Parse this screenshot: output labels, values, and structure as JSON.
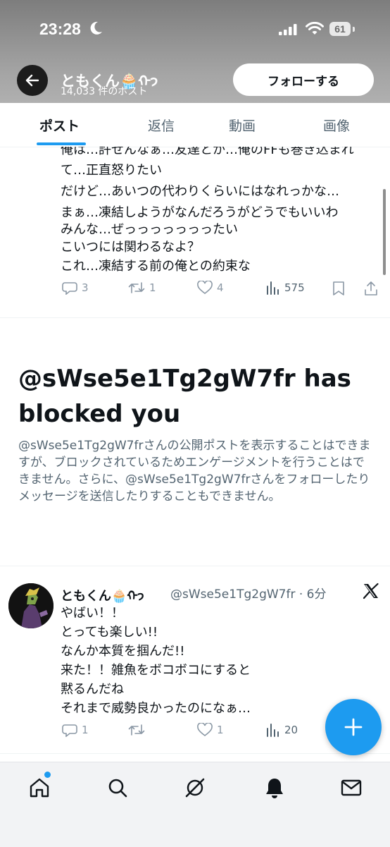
{
  "status_bar": {
    "time": "23:28",
    "battery": "61"
  },
  "header": {
    "name": "ともくん🧁ᡣ𐭩",
    "post_count": "14,033 件のポスト",
    "follow_label": "フォローする"
  },
  "tabs": [
    {
      "label": "ポスト",
      "active": true
    },
    {
      "label": "返信",
      "active": false
    },
    {
      "label": "動画",
      "active": false
    },
    {
      "label": "画像",
      "active": false
    }
  ],
  "post1": {
    "lines": [
      "俺は…許せんなぁ…友達とか…俺のFFも巻き込まれ",
      "て…正直怒りたい",
      "だけど…あいつの代わりくらいにはなれっかな…",
      "まぁ…凍結しようがなんだろうがどうでもいいわ",
      "みんな…ぜっっっっっっったい",
      "こいつには関わるなよ？",
      "これ…凍結する前の俺との約束な"
    ],
    "replies": "3",
    "reposts": "1",
    "likes": "4",
    "views": "575"
  },
  "blocked": {
    "title": "@sWse5e1Tg2gW7fr has blocked you",
    "description": "@sWse5e1Tg2gW7frさんの公開ポストを表示することはできますが、ブロックされているためエンゲージメントを行うことはできません。さらに、@sWse5e1Tg2gW7frさんをフォローしたりメッセージを送信したりすることもできません。"
  },
  "post2": {
    "name": "ともくん🧁ᡣ𐭩",
    "meta": "@sWse5e1Tg2gW7fr · 6分",
    "lines": [
      "やばい！！",
      "とっても楽しい!!",
      "なんか本質を掴んだ!!",
      "来た！！雑魚をボコボコにすると",
      "黙るんだね",
      "それまで威勢良かったのになぁ…"
    ],
    "replies": "1",
    "reposts": "",
    "likes": "1",
    "views": "20"
  },
  "colors": {
    "accent": "#1d9bf0",
    "text": "#0f1419",
    "muted": "#536471"
  },
  "bottom_nav": [
    "home-icon",
    "search-icon",
    "grok-icon",
    "notifications-icon",
    "messages-icon"
  ]
}
